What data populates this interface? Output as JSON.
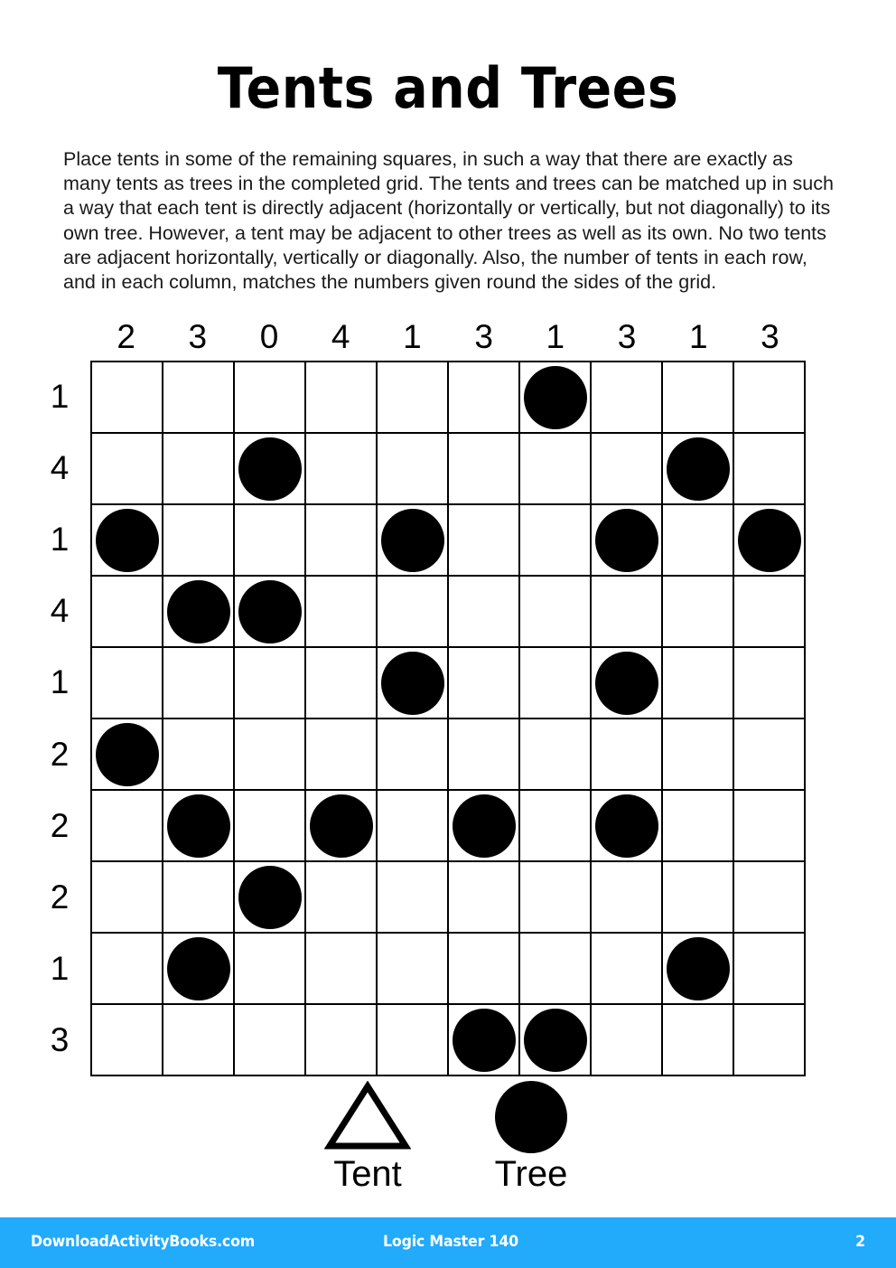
{
  "title": "Tents and Trees",
  "instructions": "Place tents in some of the remaining squares, in such a way that there are exactly as many tents as trees in the completed grid. The tents and trees can be matched up in such a way that each tent is directly adjacent (horizontally or vertically, but not diagonally) to its own tree. However, a tent may be adjacent to other trees as well as its own. No two tents are adjacent horizontally, vertically or diagonally. Also, the number of tents in each row, and in each column, matches the numbers given round the sides of the grid.",
  "puzzle": {
    "size": 10,
    "column_clues": [
      "2",
      "3",
      "0",
      "4",
      "1",
      "3",
      "1",
      "3",
      "1",
      "3"
    ],
    "row_clues": [
      "1",
      "4",
      "1",
      "4",
      "1",
      "2",
      "2",
      "2",
      "1",
      "3"
    ],
    "tree_symbol": "filled-circle",
    "grid": [
      [
        0,
        0,
        0,
        0,
        0,
        0,
        1,
        0,
        0,
        0
      ],
      [
        0,
        0,
        1,
        0,
        0,
        0,
        0,
        0,
        1,
        0
      ],
      [
        1,
        0,
        0,
        0,
        1,
        0,
        0,
        1,
        0,
        1
      ],
      [
        0,
        1,
        1,
        0,
        0,
        0,
        0,
        0,
        0,
        0
      ],
      [
        0,
        0,
        0,
        0,
        1,
        0,
        0,
        1,
        0,
        0
      ],
      [
        1,
        0,
        0,
        0,
        0,
        0,
        0,
        0,
        0,
        0
      ],
      [
        0,
        1,
        0,
        1,
        0,
        1,
        0,
        1,
        0,
        0
      ],
      [
        0,
        0,
        1,
        0,
        0,
        0,
        0,
        0,
        0,
        0
      ],
      [
        0,
        1,
        0,
        0,
        0,
        0,
        0,
        0,
        1,
        0
      ],
      [
        0,
        0,
        0,
        0,
        0,
        1,
        1,
        0,
        0,
        0
      ]
    ]
  },
  "legend": {
    "tent_label": "Tent",
    "tree_label": "Tree"
  },
  "footer": {
    "site": "DownloadActivityBooks.com",
    "book": "Logic Master 140",
    "page": "2",
    "background_color": "#22AAFB",
    "text_color": "#FFFFFF"
  }
}
